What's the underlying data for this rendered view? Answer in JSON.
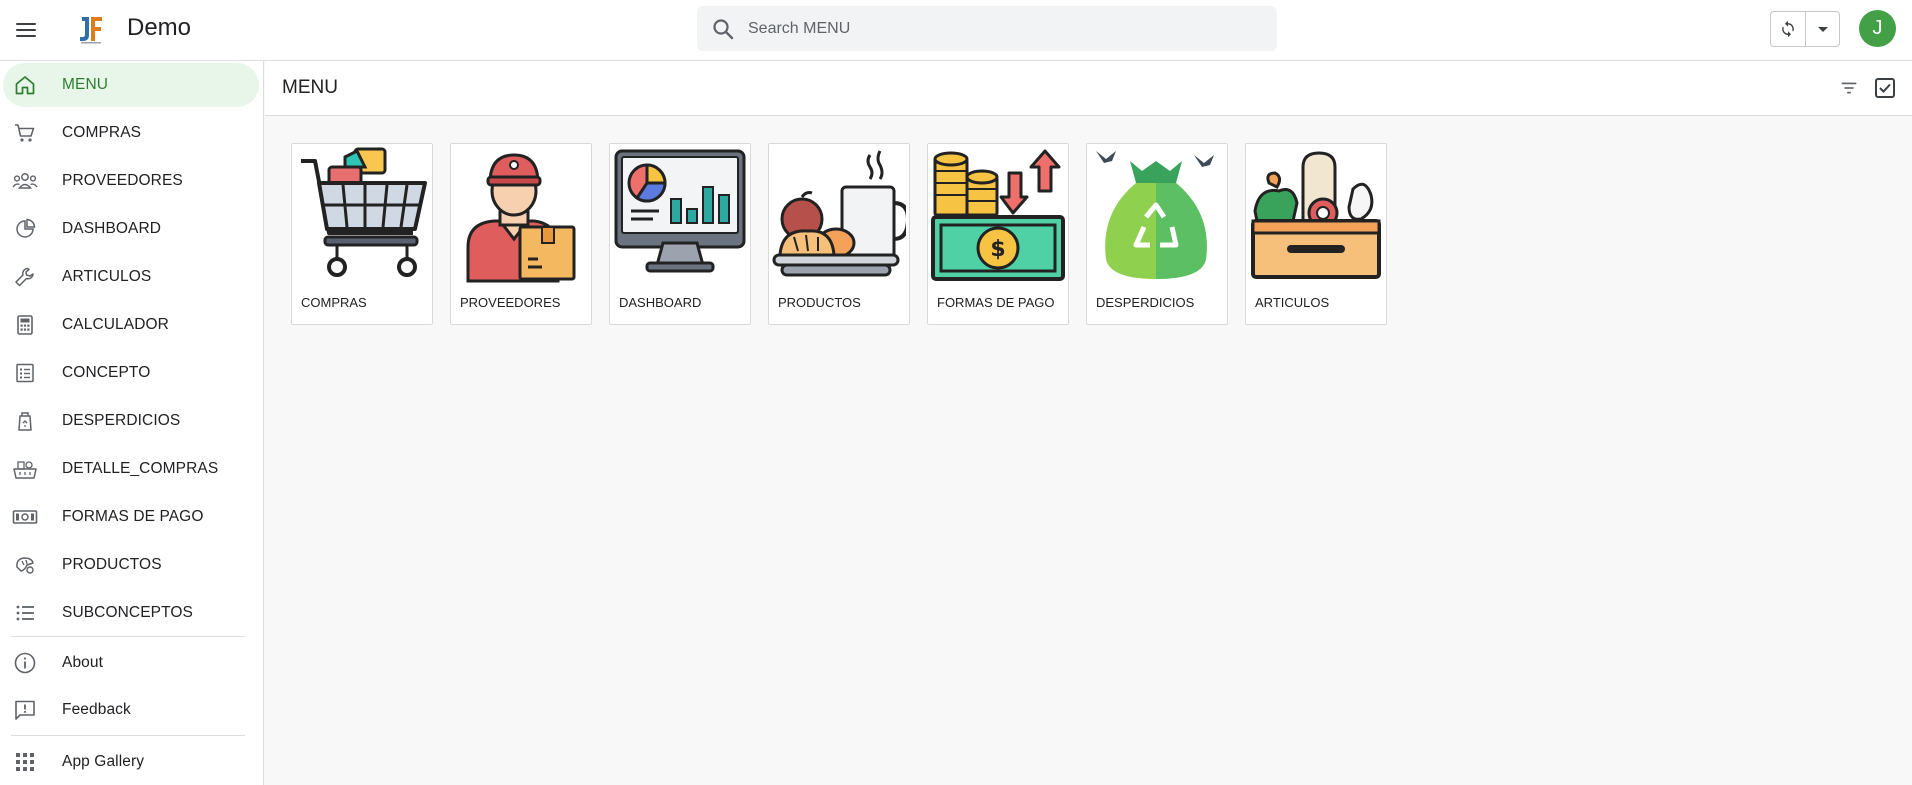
{
  "app": {
    "title": "Demo",
    "avatar_initial": "J"
  },
  "search": {
    "placeholder": "Search MENU",
    "value": ""
  },
  "sidebar": {
    "items": [
      {
        "label": "MENU",
        "icon": "home-icon",
        "active": true
      },
      {
        "label": "COMPRAS",
        "icon": "cart-icon"
      },
      {
        "label": "PROVEEDORES",
        "icon": "people-icon"
      },
      {
        "label": "DASHBOARD",
        "icon": "pie-chart-icon"
      },
      {
        "label": "ARTICULOS",
        "icon": "wrench-icon"
      },
      {
        "label": "CALCULADOR",
        "icon": "calculator-icon"
      },
      {
        "label": "CONCEPTO",
        "icon": "list-box-icon"
      },
      {
        "label": "DESPERDICIOS",
        "icon": "trash-bag-icon"
      },
      {
        "label": "DETALLE_COMPRAS",
        "icon": "basket-icon"
      },
      {
        "label": "FORMAS DE PAGO",
        "icon": "money-icon"
      },
      {
        "label": "PRODUCTOS",
        "icon": "bakery-icon"
      },
      {
        "label": "SUBCONCEPTOS",
        "icon": "list-icon"
      }
    ],
    "footer": [
      {
        "label": "About",
        "icon": "info-icon"
      },
      {
        "label": "Feedback",
        "icon": "feedback-icon"
      },
      {
        "label": "App Gallery",
        "icon": "apps-grid-icon"
      }
    ]
  },
  "main": {
    "title": "MENU",
    "cards": [
      {
        "label": "COMPRAS",
        "icon": "shopping-cart-icon"
      },
      {
        "label": "PROVEEDORES",
        "icon": "delivery-person-icon"
      },
      {
        "label": "DASHBOARD",
        "icon": "monitor-dashboard-icon"
      },
      {
        "label": "PRODUCTOS",
        "icon": "food-products-icon"
      },
      {
        "label": "FORMAS DE PAGO",
        "icon": "payment-cash-icon"
      },
      {
        "label": "DESPERDICIOS",
        "icon": "recycle-bag-icon"
      },
      {
        "label": "ARTICULOS",
        "icon": "grocery-box-icon"
      }
    ]
  },
  "colors": {
    "accent": "#2e7d32",
    "active_bg": "#e8f5e9",
    "avatar": "#43a047"
  }
}
